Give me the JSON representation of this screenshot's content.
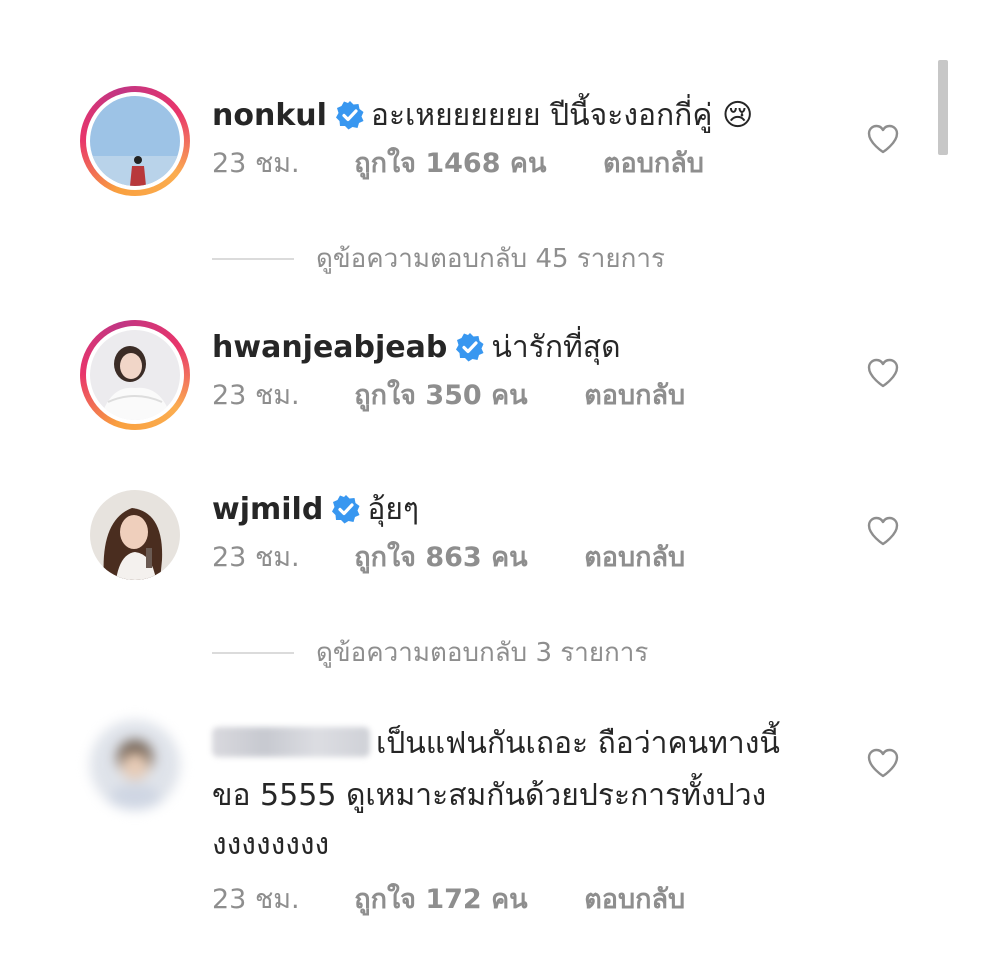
{
  "comments": [
    {
      "username": "nonkul",
      "verified": true,
      "text": "อะเหยยยยยย ปีนี้จะงอกกี่คู่",
      "emoji": "😢",
      "time": "23 ชม.",
      "likes": "ถูกใจ 1468 คน",
      "reply": "ตอบกลับ",
      "view_replies": "ดูข้อความตอบกลับ 45 รายการ"
    },
    {
      "username": "hwanjeabjeab",
      "verified": true,
      "text": "น่ารักที่สุด",
      "time": "23 ชม.",
      "likes": "ถูกใจ 350 คน",
      "reply": "ตอบกลับ"
    },
    {
      "username": "wjmild",
      "verified": true,
      "text": "อุ้ยๆ",
      "time": "23 ชม.",
      "likes": "ถูกใจ 863 คน",
      "reply": "ตอบกลับ",
      "view_replies": "ดูข้อความตอบกลับ 3 รายการ"
    },
    {
      "username": "",
      "verified": false,
      "text_line1": "เป็นแฟนกันเถอะ ถือว่าคนทางนี้",
      "text_line2": "ขอ 5555 ดูเหมาะสมกันด้วยประการทั้งปวง",
      "text_line3": "งงงงงงงง",
      "time": "23 ชม.",
      "likes": "ถูกใจ 172 คน",
      "reply": "ตอบกลับ"
    }
  ],
  "icons": {
    "verified": "verified-badge-icon",
    "like": "heart-icon"
  },
  "colors": {
    "verified_blue": "#3897f0",
    "secondary_text": "#8e8e8e",
    "primary_text": "#262626"
  }
}
